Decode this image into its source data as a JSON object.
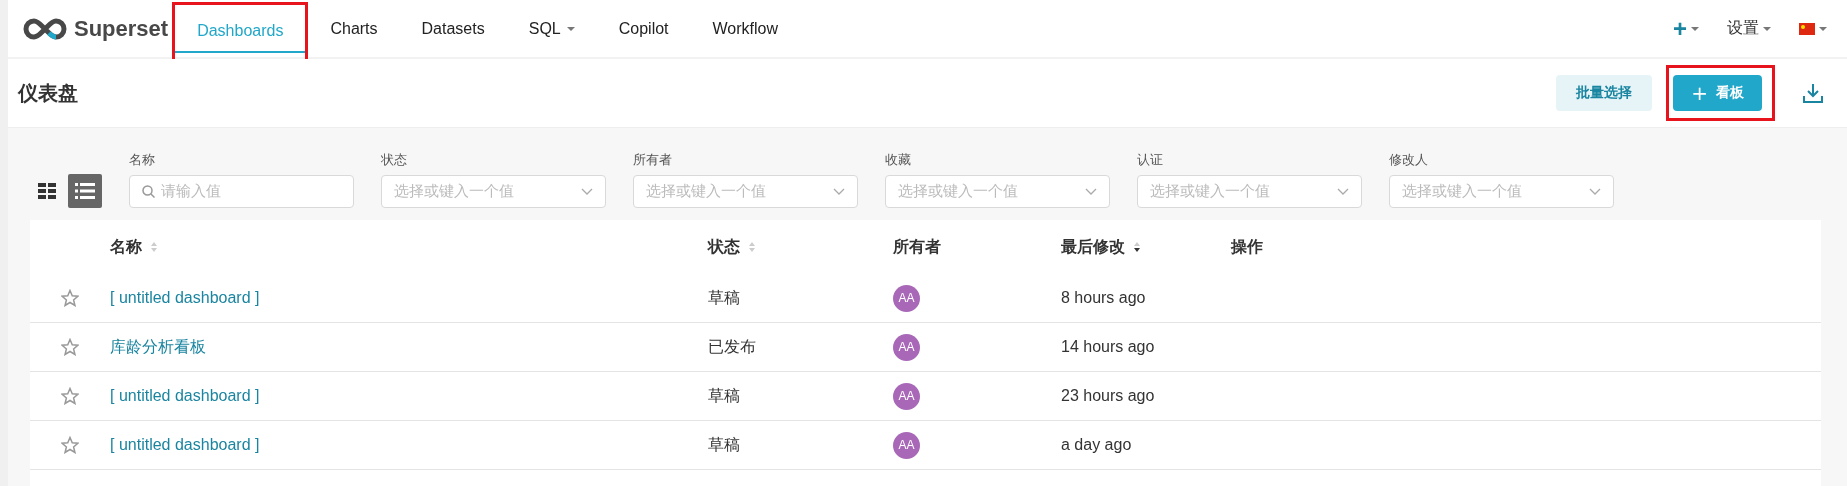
{
  "nav": {
    "brand": "Superset",
    "tabs": [
      {
        "label": "Dashboards",
        "selected": true,
        "dropdown": false,
        "highlighted": true
      },
      {
        "label": "Charts",
        "selected": false,
        "dropdown": false,
        "highlighted": false
      },
      {
        "label": "Datasets",
        "selected": false,
        "dropdown": false,
        "highlighted": false
      },
      {
        "label": "SQL",
        "selected": false,
        "dropdown": true,
        "highlighted": false
      },
      {
        "label": "Copilot",
        "selected": false,
        "dropdown": false,
        "highlighted": false
      },
      {
        "label": "Workflow",
        "selected": false,
        "dropdown": false,
        "highlighted": false
      }
    ],
    "right": {
      "add": "+",
      "settings": "设置"
    }
  },
  "header": {
    "title": "仪表盘",
    "bulk_select": "批量选择",
    "create": {
      "icon": "+",
      "label": "看板",
      "highlighted": true
    }
  },
  "view_toggle": [
    {
      "kind": "card",
      "selected": false
    },
    {
      "kind": "list",
      "selected": true
    }
  ],
  "filters": [
    {
      "label": "名称",
      "kind": "search",
      "placeholder": "请输入值"
    },
    {
      "label": "状态",
      "kind": "select",
      "placeholder": "选择或键入一个值"
    },
    {
      "label": "所有者",
      "kind": "select",
      "placeholder": "选择或键入一个值"
    },
    {
      "label": "收藏",
      "kind": "select",
      "placeholder": "选择或键入一个值"
    },
    {
      "label": "认证",
      "kind": "select",
      "placeholder": "选择或键入一个值"
    },
    {
      "label": "修改人",
      "kind": "select",
      "placeholder": "选择或键入一个值"
    }
  ],
  "table": {
    "columns": [
      {
        "label": "名称",
        "sortable": true,
        "sorted": false
      },
      {
        "label": "状态",
        "sortable": true,
        "sorted": false
      },
      {
        "label": "所有者",
        "sortable": false
      },
      {
        "label": "最后修改",
        "sortable": true,
        "sorted": true
      },
      {
        "label": "操作",
        "sortable": false
      }
    ],
    "rows": [
      {
        "starred": false,
        "name": "[ untitled dashboard ]",
        "status": "草稿",
        "owner": "AA",
        "modified": "8 hours ago"
      },
      {
        "starred": false,
        "name": "库龄分析看板",
        "status": "已发布",
        "owner": "AA",
        "modified": "14 hours ago"
      },
      {
        "starred": false,
        "name": "[ untitled dashboard ]",
        "status": "草稿",
        "owner": "AA",
        "modified": "23 hours ago"
      },
      {
        "starred": false,
        "name": "[ untitled dashboard ]",
        "status": "草稿",
        "owner": "AA",
        "modified": "a day ago"
      }
    ]
  }
}
